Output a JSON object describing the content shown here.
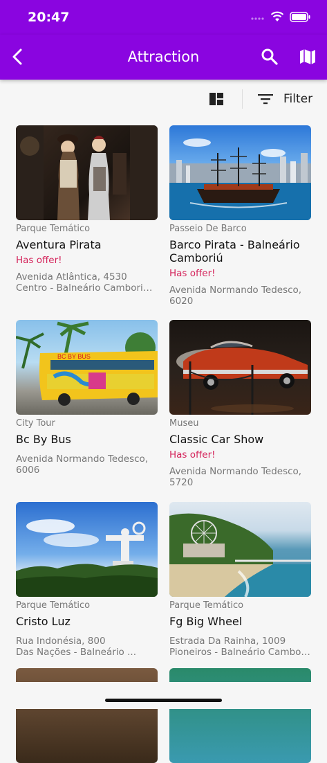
{
  "status": {
    "time": "20:47"
  },
  "header": {
    "title": "Attraction"
  },
  "toolbar": {
    "filter_label": "Filter"
  },
  "colors": {
    "primary": "#8a05e0",
    "offer": "#d4235a"
  },
  "attractions": [
    {
      "category": "Parque Temático",
      "name": "Aventura Pirata",
      "offer": "Has offer!",
      "address_1": "Avenida Atlântica, 4530",
      "address_2": "Centro - Balneário Camboriú - ..."
    },
    {
      "category": "Passeio De Barco",
      "name": "Barco Pirata - Balneário Camboriú",
      "offer": "Has offer!",
      "address_1": "Avenida Normando Tedesco,",
      "address_2": "6020"
    },
    {
      "category": "City Tour",
      "name": "Bc By Bus",
      "offer": "",
      "address_1": "Avenida Normando Tedesco,",
      "address_2": "6006"
    },
    {
      "category": "Museu",
      "name": "Classic Car Show",
      "offer": "Has offer!",
      "address_1": "Avenida Normando Tedesco,",
      "address_2": "5720"
    },
    {
      "category": "Parque Temático",
      "name": "Cristo Luz",
      "offer": "",
      "address_1": "Rua Indonésia, 800",
      "address_2": "Das Nações - Balneário ..."
    },
    {
      "category": "Parque Temático",
      "name": "Fg Big Wheel",
      "offer": "",
      "address_1": "Estrada Da Rainha, 1009",
      "address_2": "Pioneiros - Balneário Cambori..."
    }
  ]
}
